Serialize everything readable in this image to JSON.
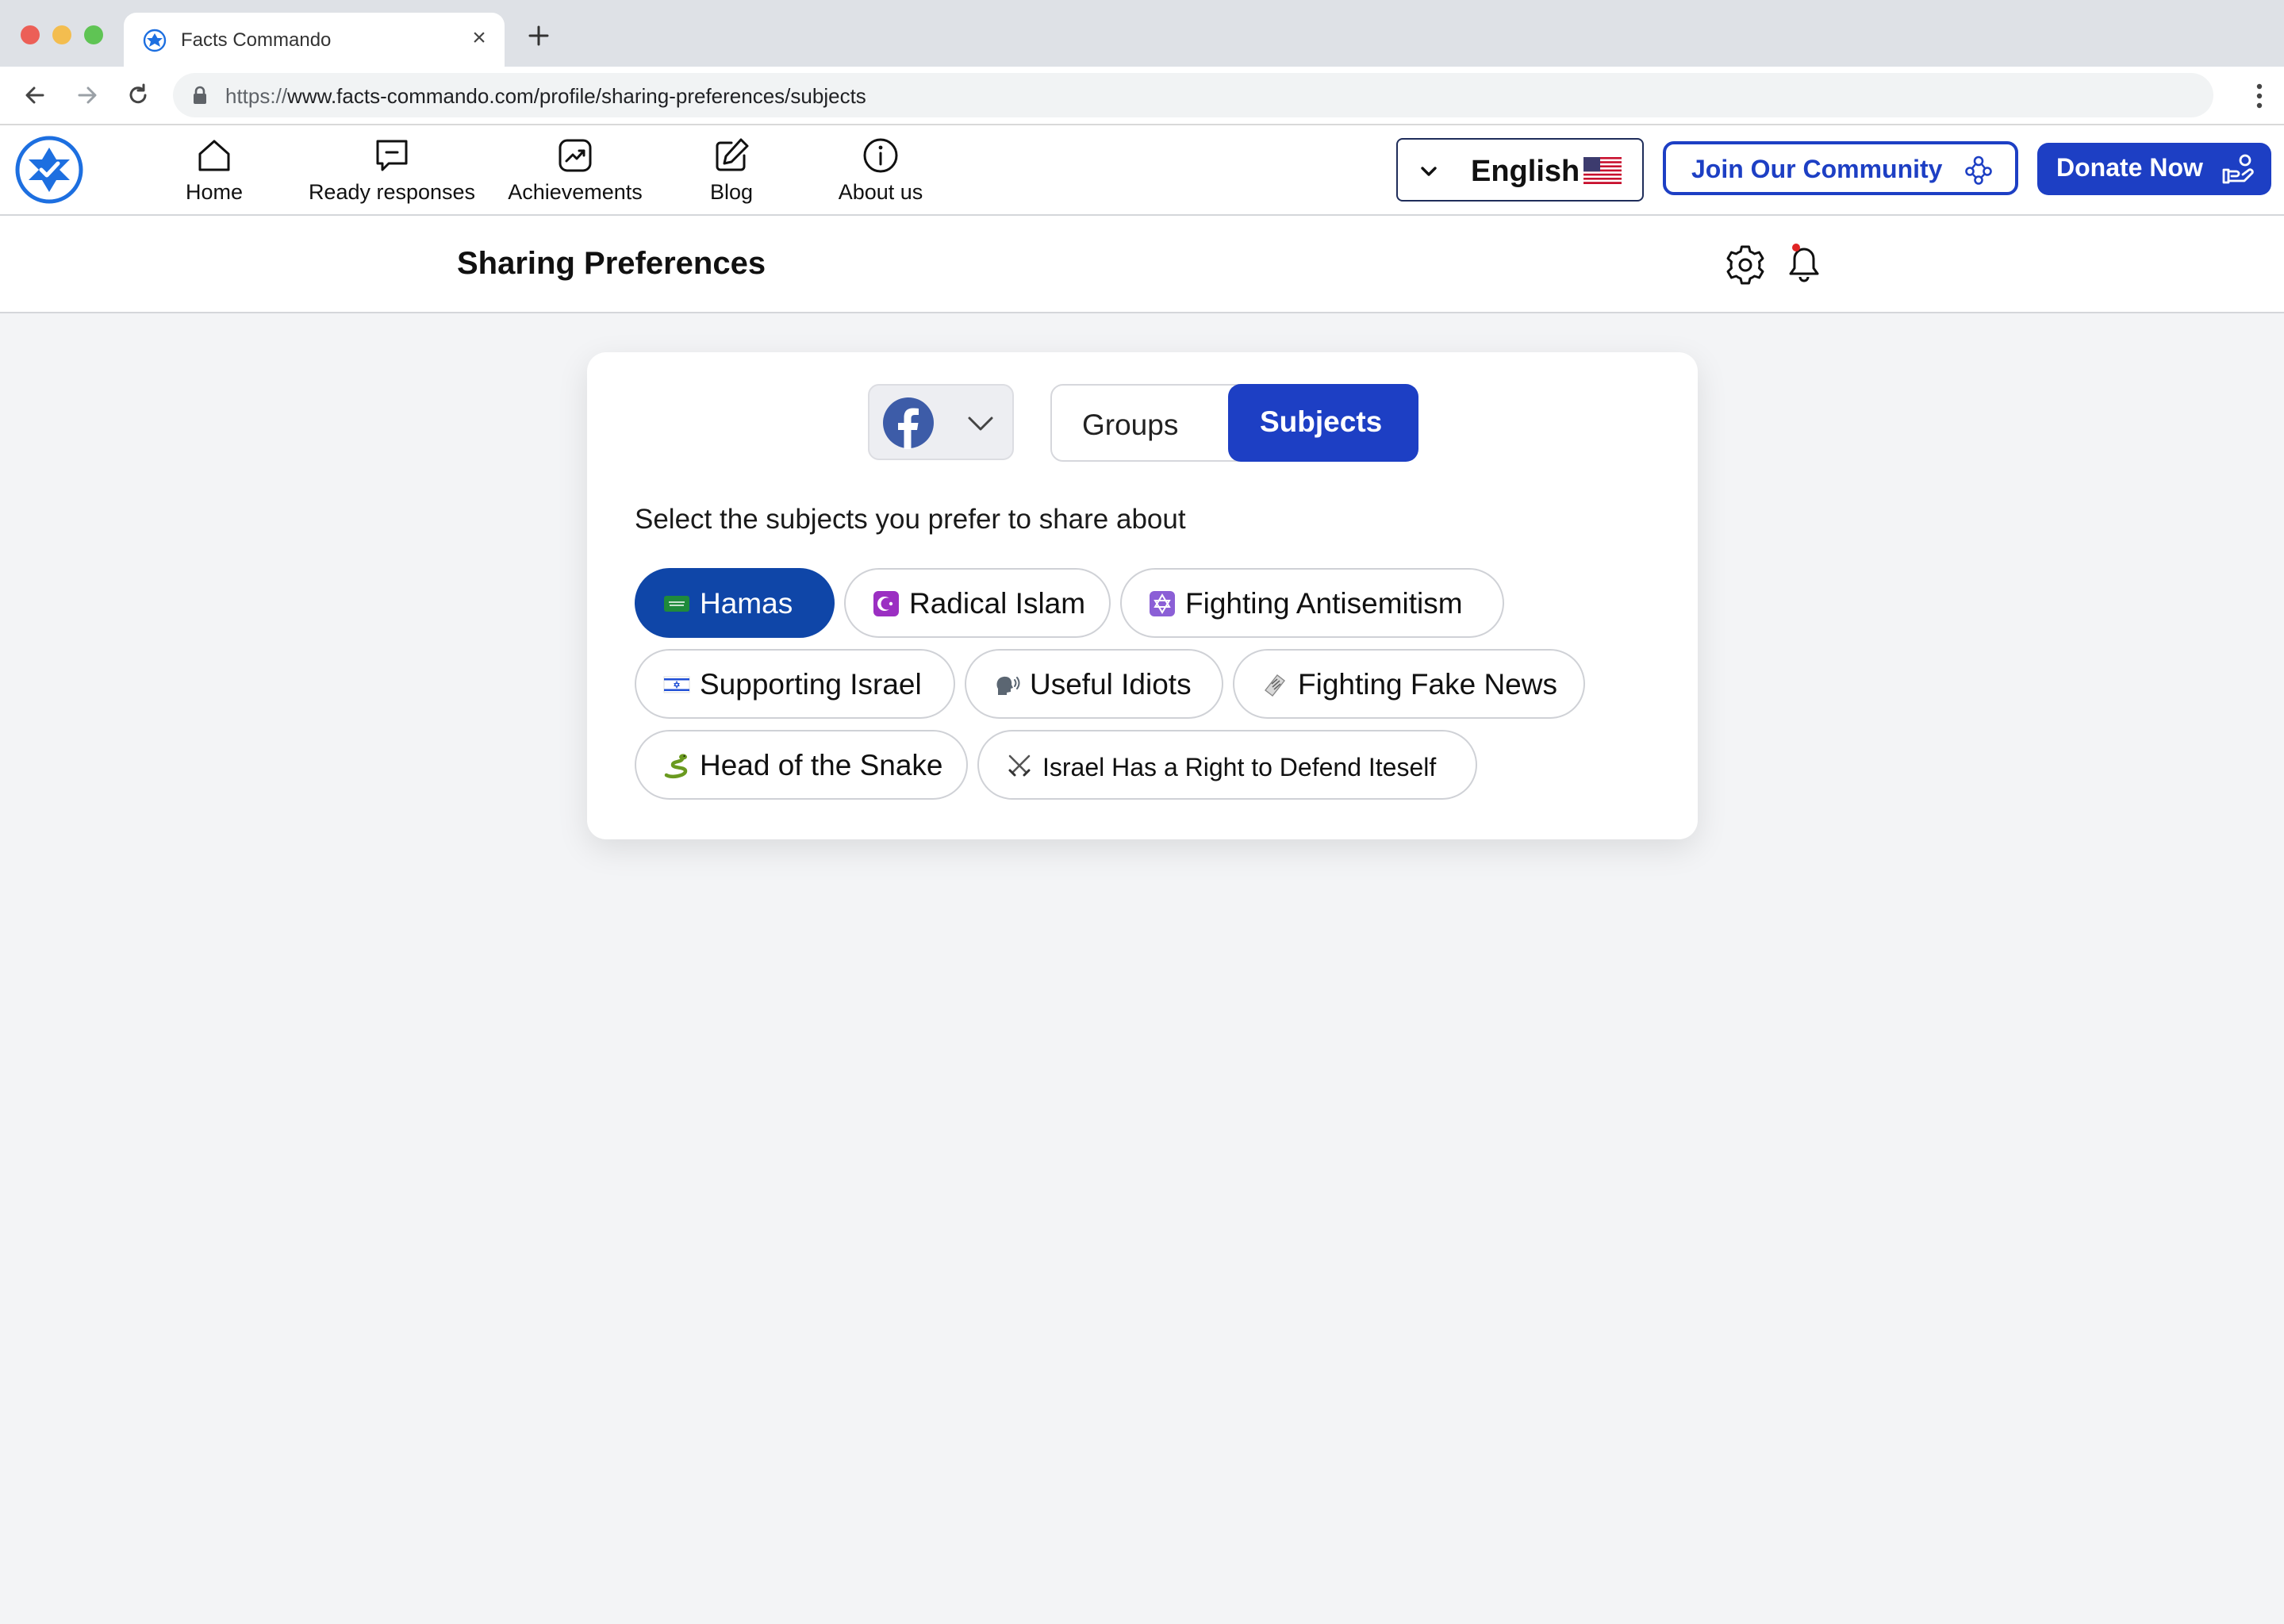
{
  "browser": {
    "tab_title": "Facts Commando",
    "url_scheme": "https://",
    "url_rest": "www.facts-commando.com/profile/sharing-preferences/subjects"
  },
  "header": {
    "nav": [
      {
        "label": "Home",
        "icon": "home-icon"
      },
      {
        "label": "Ready responses",
        "icon": "chat-icon"
      },
      {
        "label": "Achievements",
        "icon": "trending-icon"
      },
      {
        "label": "Blog",
        "icon": "edit-icon"
      },
      {
        "label": "About us",
        "icon": "info-icon"
      }
    ],
    "language": {
      "label": "English",
      "flag": "us-flag-icon"
    },
    "join_label": "Join Our Community",
    "donate_label": "Donate Now"
  },
  "page": {
    "title": "Sharing Preferences"
  },
  "preferences": {
    "platform": "facebook-icon",
    "tabs": {
      "groups": "Groups",
      "subjects": "Subjects",
      "active": "Subjects"
    },
    "prompt": "Select the subjects you prefer to share about",
    "subjects": [
      {
        "label": "Hamas",
        "emoji": "flag-icon",
        "selected": true
      },
      {
        "label": "Radical Islam",
        "emoji": "star-and-crescent-icon",
        "selected": false
      },
      {
        "label": "Fighting Antisemitism",
        "emoji": "star-of-david-icon",
        "selected": false
      },
      {
        "label": "Supporting Israel",
        "emoji": "israel-flag-icon",
        "selected": false
      },
      {
        "label": "Useful Idiots",
        "emoji": "speaking-head-icon",
        "selected": false
      },
      {
        "label": "Fighting Fake News",
        "emoji": "newspaper-icon",
        "selected": false
      },
      {
        "label": "Head of the Snake",
        "emoji": "snake-icon",
        "selected": false
      },
      {
        "label": "Israel Has a Right to Defend Iteself",
        "emoji": "crossed-swords-icon",
        "selected": false
      }
    ]
  },
  "colors": {
    "accent": "#1d3fc4",
    "selected_chip": "#0f46a8",
    "page_background": "#f3f4f6"
  }
}
